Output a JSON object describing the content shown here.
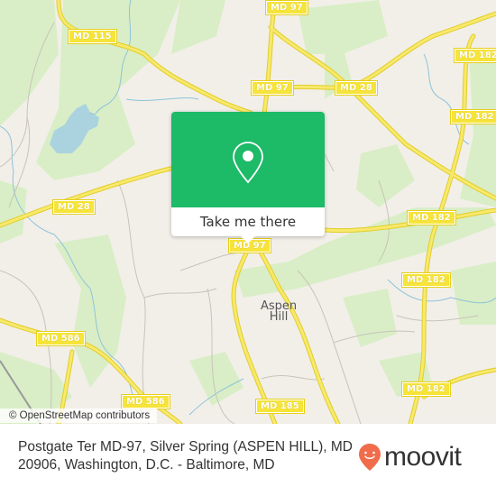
{
  "map": {
    "road_labels": [
      {
        "text": "MD 97"
      },
      {
        "text": "MD 115"
      },
      {
        "text": "MD 182"
      },
      {
        "text": "MD 97"
      },
      {
        "text": "MD 28"
      },
      {
        "text": "MD 182"
      },
      {
        "text": "MD 28"
      },
      {
        "text": "MD 182"
      },
      {
        "text": "MD 97"
      },
      {
        "text": "MD 182"
      },
      {
        "text": "MD 586"
      },
      {
        "text": "MD 586"
      },
      {
        "text": "MD 185"
      },
      {
        "text": "MD 182"
      }
    ],
    "place_label": "Aspen\nHill",
    "attribution": "© OpenStreetMap contributors",
    "colors": {
      "land": "#f2efe9",
      "park": "#d9eec6",
      "water": "#aad3df",
      "road_major": "#f6e43a",
      "road_minor": "#c8c3bb"
    }
  },
  "popup": {
    "icon": "map-pin-icon",
    "button_label": "Take me there",
    "color": "#1dba67"
  },
  "footer": {
    "address": "Postgate Ter MD-97, Silver Spring (ASPEN HILL), MD 20906, Washington, D.C. - Baltimore, MD",
    "brand": "moovit",
    "brand_color": "#f06c4a"
  }
}
